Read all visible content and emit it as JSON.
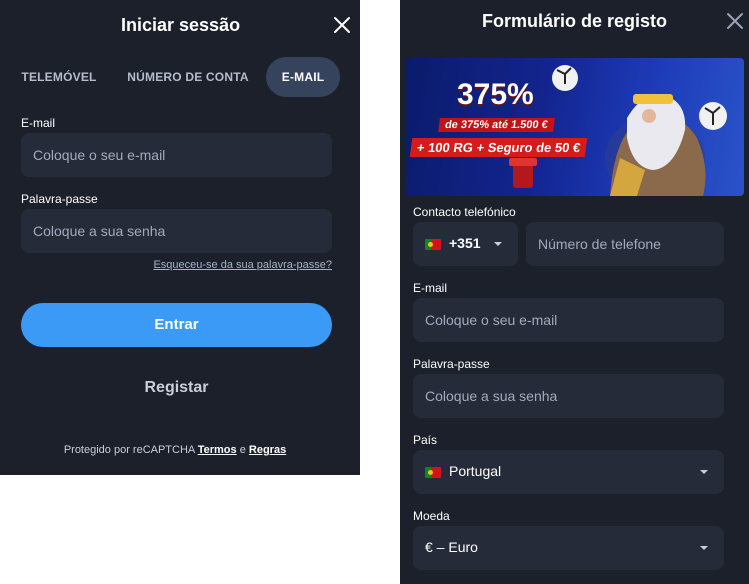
{
  "login": {
    "title": "Iniciar sessão",
    "tabs": [
      {
        "label": "TELEMÓVEL",
        "active": false
      },
      {
        "label": "NÚMERO DE CONTA",
        "active": false
      },
      {
        "label": "E-MAIL",
        "active": true
      }
    ],
    "email": {
      "label": "E-mail",
      "placeholder": "Coloque o seu e-mail"
    },
    "password": {
      "label": "Palavra-passe",
      "placeholder": "Coloque a sua senha"
    },
    "forgot": "Esqueceu-se da sua palavra-passe?",
    "submit": "Entrar",
    "register": "Registar",
    "recaptcha": {
      "prefix": "Protegido por reCAPTCHA",
      "terms": "Termos",
      "and": "e",
      "rules": "Regras"
    }
  },
  "register": {
    "title": "Formulário de registo",
    "banner": {
      "headline": "375%",
      "line1": "de 375% até 1.500 €",
      "line2": "+ 100 RG + Seguro de 50 €"
    },
    "phone": {
      "label": "Contacto telefónico",
      "code": "+351",
      "placeholder": "Número de telefone"
    },
    "email": {
      "label": "E-mail",
      "placeholder": "Coloque o seu e-mail"
    },
    "password": {
      "label": "Palavra-passe",
      "placeholder": "Coloque a sua senha"
    },
    "country": {
      "label": "País",
      "value": "Portugal"
    },
    "currency": {
      "label": "Moeda",
      "value": "€ – Euro"
    }
  },
  "colors": {
    "panel_bg": "#1b202b",
    "input_bg": "#252b39",
    "primary": "#3b9af6",
    "active_tab": "#35435c"
  }
}
